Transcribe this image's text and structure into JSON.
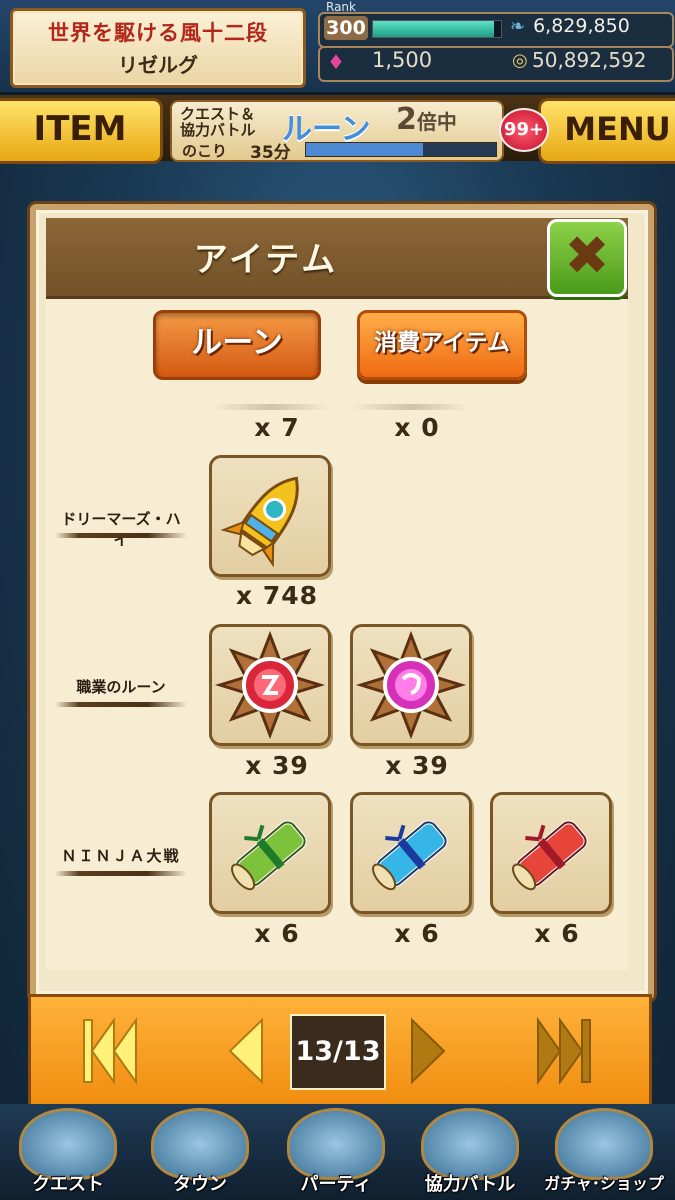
{
  "header": {
    "title_line1": "世界を駆ける風十二段",
    "title_line2": "リゼルグ",
    "rank_label": "Rank",
    "rank_value": "300",
    "rank_progress": 0.95,
    "currency_top": "6,829,850",
    "gems": "1,500",
    "coins": "50,892,592"
  },
  "menu_bar": {
    "item_label": "ITEM",
    "menu_label": "MENU",
    "badge": "99+",
    "event_line1": "クエスト＆",
    "event_line2": "協力バトル",
    "event_rune": "ルーン",
    "event_multiplier": "2",
    "event_multiplier_suffix": "倍中",
    "remaining_label": "のこり",
    "remaining_time": "35分",
    "remaining_progress": 0.62
  },
  "modal": {
    "title": "アイテム",
    "tabs": {
      "rune": "ルーン",
      "consumable": "消費アイテム"
    },
    "top_counts": [
      "x 7",
      "x 0"
    ],
    "rows": [
      {
        "label": "ドリーマーズ・ハイ",
        "items": [
          {
            "icon": "rocket-icon",
            "count": "x 748"
          }
        ]
      },
      {
        "label": "職業のルーン",
        "items": [
          {
            "icon": "red-job-rune-icon",
            "count": "x 39"
          },
          {
            "icon": "pink-job-rune-icon",
            "count": "x 39"
          }
        ]
      },
      {
        "label": "ＮＩＮＪＡ大戦",
        "items": [
          {
            "icon": "green-scroll-icon",
            "count": "x 6"
          },
          {
            "icon": "blue-scroll-icon",
            "count": "x 6"
          },
          {
            "icon": "red-scroll-icon",
            "count": "x 6"
          }
        ]
      }
    ]
  },
  "pager": {
    "page": "13/13"
  },
  "bottom_nav": [
    "クエスト",
    "タウン",
    "パーティ",
    "協力バトル",
    "ガチャ･ショップ"
  ],
  "colors": {
    "accent_orange": "#f08d10",
    "frame_brown": "#7a5626",
    "close_green": "#6cba2e"
  }
}
